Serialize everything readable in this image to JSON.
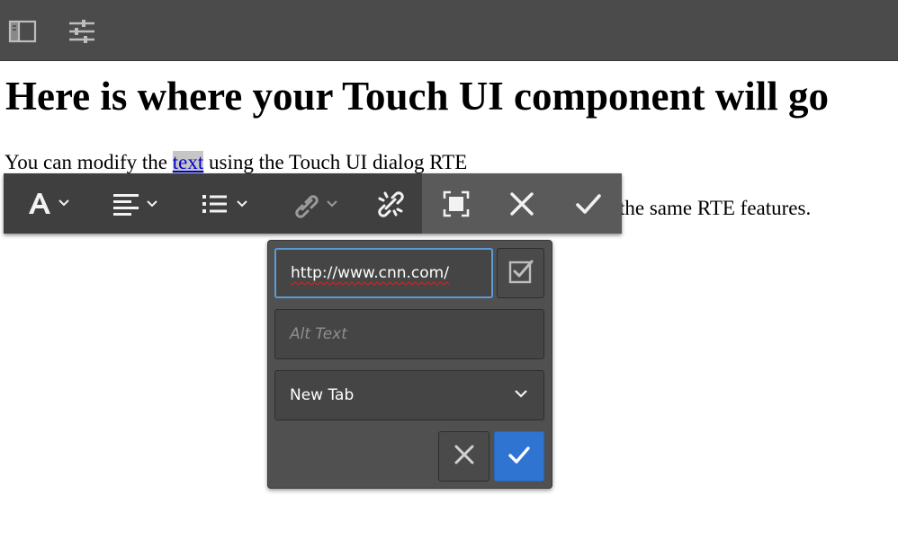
{
  "topbar": {
    "icons": [
      "side-panel-icon",
      "properties-sliders-icon"
    ]
  },
  "content": {
    "heading": "Here is where your Touch UI component will go",
    "para1_before": "You can modify the ",
    "para1_link": "text",
    "para1_after": " using the Touch UI dialog RTE",
    "para2_visible": "the same RTE features."
  },
  "rte_toolbar": {
    "buttons": [
      "format-icon",
      "justify-icon",
      "list-icon",
      "link-icon",
      "unlink-icon",
      "fullscreen-icon",
      "close-icon",
      "done-icon"
    ]
  },
  "link_dialog": {
    "url_value": "http://www.cnn.com/",
    "alt_placeholder": "Alt Text",
    "target_selected": "New Tab"
  },
  "colors": {
    "topbar": "#4b4b4b",
    "toolbar": "#3f3f3f",
    "toolbar_mode_group": "#5a5a5a",
    "popover": "#505050",
    "field_focus_border": "#5b9bd8",
    "apply_button": "#2f74d0",
    "link_text": "#0000cc"
  }
}
